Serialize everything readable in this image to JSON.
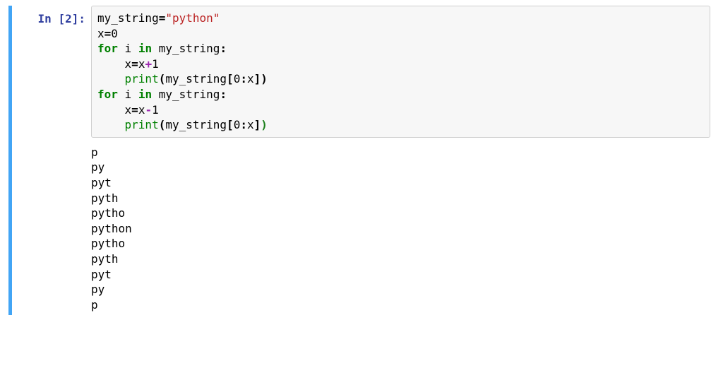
{
  "cell": {
    "prompt": {
      "label": "In",
      "number": "2",
      "suffix": ":"
    },
    "code": {
      "tokens": [
        [
          {
            "c": "tok-nam",
            "t": "my_string"
          },
          {
            "c": "tok-op",
            "t": "="
          },
          {
            "c": "tok-str",
            "t": "\"python\""
          }
        ],
        [
          {
            "c": "tok-nam",
            "t": "x"
          },
          {
            "c": "tok-op",
            "t": "="
          },
          {
            "c": "tok-num",
            "t": "0"
          }
        ],
        [
          {
            "c": "tok-kw",
            "t": "for"
          },
          {
            "c": "",
            "t": " "
          },
          {
            "c": "tok-nam",
            "t": "i"
          },
          {
            "c": "",
            "t": " "
          },
          {
            "c": "tok-kw",
            "t": "in"
          },
          {
            "c": "",
            "t": " "
          },
          {
            "c": "tok-nam",
            "t": "my_string"
          },
          {
            "c": "tok-pun",
            "t": ":"
          }
        ],
        [
          {
            "c": "",
            "t": "    "
          },
          {
            "c": "tok-nam",
            "t": "x"
          },
          {
            "c": "tok-op",
            "t": "="
          },
          {
            "c": "tok-nam",
            "t": "x"
          },
          {
            "c": "tok-math",
            "t": "+"
          },
          {
            "c": "tok-num",
            "t": "1"
          }
        ],
        [
          {
            "c": "",
            "t": "    "
          },
          {
            "c": "tok-bi",
            "t": "print"
          },
          {
            "c": "tok-brl",
            "t": "("
          },
          {
            "c": "tok-nam",
            "t": "my_string"
          },
          {
            "c": "tok-pun",
            "t": "["
          },
          {
            "c": "tok-num",
            "t": "0"
          },
          {
            "c": "tok-pun",
            "t": ":"
          },
          {
            "c": "tok-nam",
            "t": "x"
          },
          {
            "c": "tok-pun",
            "t": "]"
          },
          {
            "c": "tok-brl",
            "t": ")"
          }
        ],
        [
          {
            "c": "tok-kw",
            "t": "for"
          },
          {
            "c": "",
            "t": " "
          },
          {
            "c": "tok-nam",
            "t": "i"
          },
          {
            "c": "",
            "t": " "
          },
          {
            "c": "tok-kw",
            "t": "in"
          },
          {
            "c": "",
            "t": " "
          },
          {
            "c": "tok-nam",
            "t": "my_string"
          },
          {
            "c": "tok-pun",
            "t": ":"
          }
        ],
        [
          {
            "c": "",
            "t": "    "
          },
          {
            "c": "tok-nam",
            "t": "x"
          },
          {
            "c": "tok-op",
            "t": "="
          },
          {
            "c": "tok-nam",
            "t": "x"
          },
          {
            "c": "tok-math",
            "t": "-"
          },
          {
            "c": "tok-num",
            "t": "1"
          }
        ],
        [
          {
            "c": "",
            "t": "    "
          },
          {
            "c": "tok-bi",
            "t": "print"
          },
          {
            "c": "tok-brl",
            "t": "("
          },
          {
            "c": "tok-nam",
            "t": "my_string"
          },
          {
            "c": "tok-pun",
            "t": "["
          },
          {
            "c": "tok-num",
            "t": "0"
          },
          {
            "c": "tok-pun",
            "t": ":"
          },
          {
            "c": "tok-nam",
            "t": "x"
          },
          {
            "c": "tok-pun",
            "t": "]"
          },
          {
            "c": "tok-brc",
            "t": ")"
          }
        ]
      ]
    },
    "output_lines": [
      "p",
      "py",
      "pyt",
      "pyth",
      "pytho",
      "python",
      "pytho",
      "pyth",
      "pyt",
      "py",
      "p"
    ]
  }
}
